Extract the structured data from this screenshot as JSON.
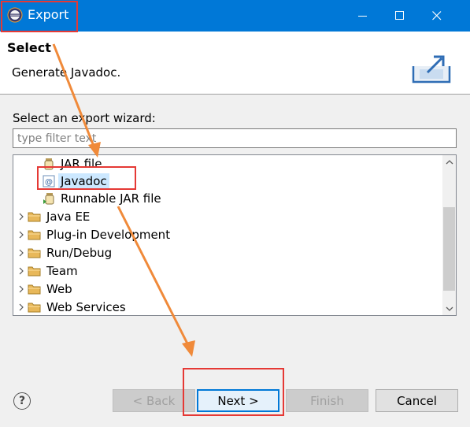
{
  "window": {
    "title": "Export",
    "titlebar_color": "#0078d7",
    "icons": {
      "app": "eclipse-icon",
      "minimize": "minimize-icon",
      "maximize": "maximize-icon",
      "close": "close-icon"
    }
  },
  "header": {
    "title": "Select",
    "description": "Generate Javadoc.",
    "banner_icon": "export-wizard-banner-icon"
  },
  "wizard": {
    "label": "Select an export wizard:",
    "filter_placeholder": "type filter text",
    "filter_value": "",
    "tree": [
      {
        "label": "JAR file",
        "icon": "jar-file-icon",
        "level": 2,
        "expandable": false,
        "selected": false
      },
      {
        "label": "Javadoc",
        "icon": "javadoc-icon",
        "level": 2,
        "expandable": false,
        "selected": true
      },
      {
        "label": "Runnable JAR file",
        "icon": "runnable-jar-icon",
        "level": 2,
        "expandable": false,
        "selected": false
      },
      {
        "label": "Java EE",
        "icon": "folder-icon",
        "level": 1,
        "expandable": true,
        "selected": false
      },
      {
        "label": "Plug-in Development",
        "icon": "folder-icon",
        "level": 1,
        "expandable": true,
        "selected": false
      },
      {
        "label": "Run/Debug",
        "icon": "folder-icon",
        "level": 1,
        "expandable": true,
        "selected": false
      },
      {
        "label": "Team",
        "icon": "folder-icon",
        "level": 1,
        "expandable": true,
        "selected": false
      },
      {
        "label": "Web",
        "icon": "folder-icon",
        "level": 1,
        "expandable": true,
        "selected": false
      },
      {
        "label": "Web Services",
        "icon": "folder-icon",
        "level": 1,
        "expandable": true,
        "selected": false
      }
    ]
  },
  "buttons": {
    "help": "?",
    "back": "< Back",
    "next": "Next >",
    "finish": "Finish",
    "cancel": "Cancel"
  },
  "annotations": {
    "box_color": "#e53935",
    "arrow_color": "#f08a3a",
    "highlighted": [
      "Export",
      "Javadoc",
      "Next >"
    ]
  }
}
